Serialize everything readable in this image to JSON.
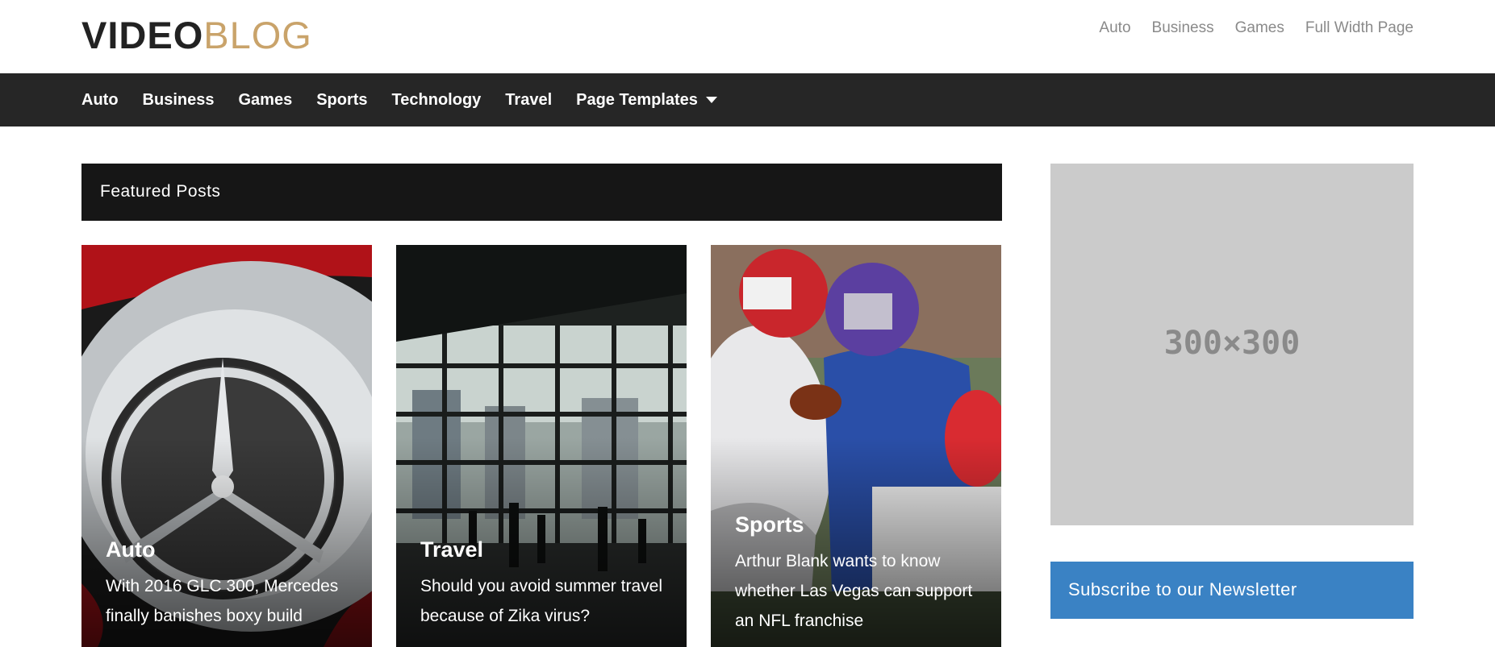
{
  "logo": {
    "part1": "VIDEO",
    "part2": "BLOG"
  },
  "top_menu": [
    "Auto",
    "Business",
    "Games",
    "Full Width Page"
  ],
  "main_menu": [
    "Auto",
    "Business",
    "Games",
    "Sports",
    "Technology",
    "Travel",
    "Page Templates"
  ],
  "featured": {
    "heading": "Featured Posts",
    "posts": [
      {
        "category": "Auto",
        "title": "With 2016 GLC 300, Mercedes finally banishes boxy build"
      },
      {
        "category": "Travel",
        "title": "Should you avoid summer travel because of Zika virus?"
      },
      {
        "category": "Sports",
        "title": "Arthur Blank wants to know whether Las Vegas can support an NFL franchise"
      }
    ]
  },
  "sidebar": {
    "ad_label": "300×300",
    "newsletter": "Subscribe to our Newsletter"
  },
  "colors": {
    "nav_bg": "#262626",
    "accent_gold": "#c9a36a",
    "newsletter_blue": "#3a82c4"
  }
}
